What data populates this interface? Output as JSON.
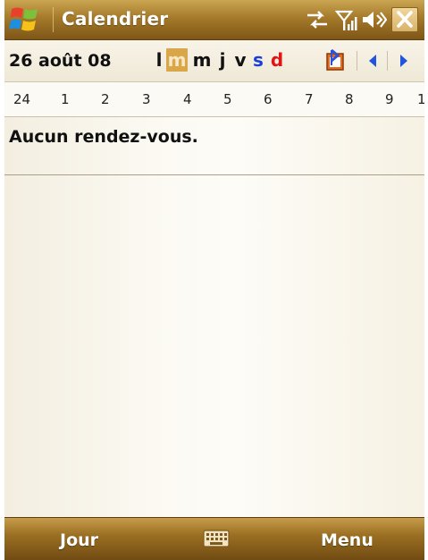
{
  "titlebar": {
    "title": "Calendrier",
    "icons": [
      "windows-start-icon",
      "connectivity-icon",
      "signal-strength-icon",
      "volume-icon",
      "close-icon"
    ]
  },
  "date_header": {
    "date": "26 août 08",
    "weekdays": [
      {
        "label": "l",
        "color": "#111111",
        "selected": false
      },
      {
        "label": "m",
        "color": "#f7e8c6",
        "selected": true
      },
      {
        "label": "m",
        "color": "#111111",
        "selected": false
      },
      {
        "label": "j",
        "color": "#111111",
        "selected": false
      },
      {
        "label": "v",
        "color": "#111111",
        "selected": false
      },
      {
        "label": "s",
        "color": "#1a3fd6",
        "selected": false
      },
      {
        "label": "d",
        "color": "#e01515",
        "selected": false
      }
    ],
    "icons": [
      "go-to-today-icon",
      "previous-arrow-icon",
      "next-arrow-icon"
    ]
  },
  "hour_scale": {
    "hours": [
      "24",
      "1",
      "2",
      "3",
      "4",
      "5",
      "6",
      "7",
      "8",
      "9",
      "1"
    ]
  },
  "content": {
    "empty_message": "Aucun rendez-vous."
  },
  "softkeys": {
    "left": "Jour",
    "right": "Menu",
    "center_icon": "keyboard-icon"
  },
  "colors": {
    "accent_gold": "#d9a64a",
    "saturday_blue": "#1a3fd6",
    "sunday_red": "#e01515",
    "arrow_blue": "#2255dd"
  }
}
